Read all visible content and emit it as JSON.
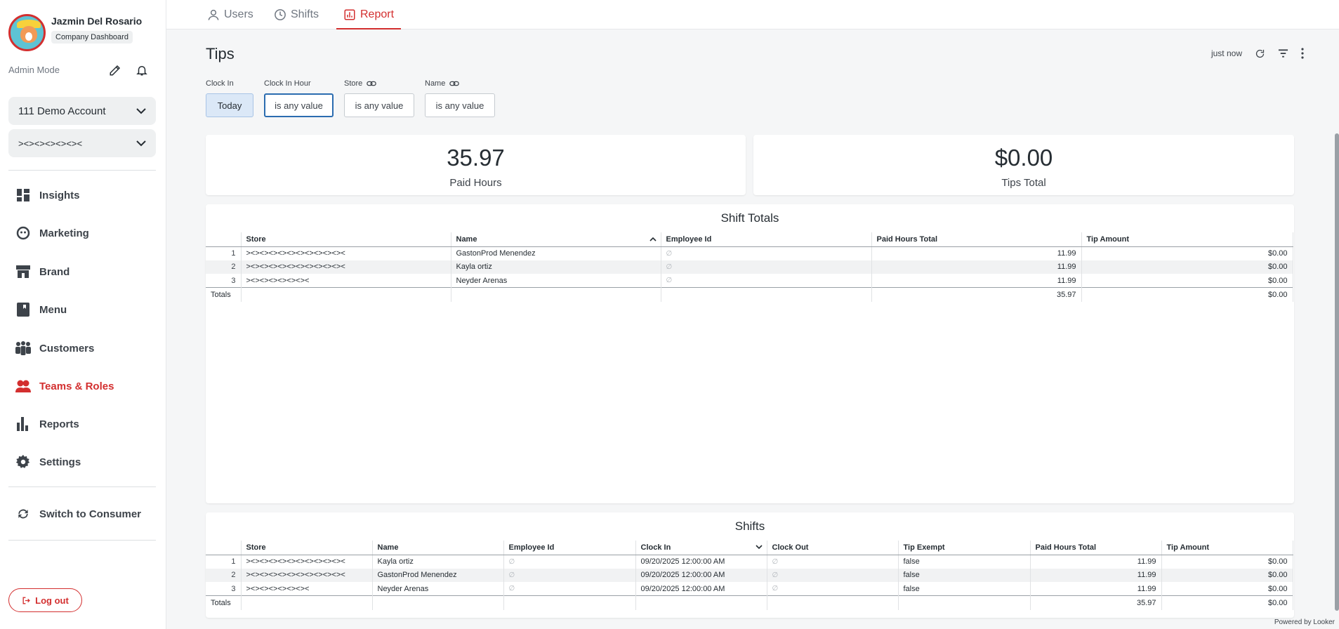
{
  "profile": {
    "name": "Jazmin Del Rosario",
    "company": "Company Dashboard"
  },
  "admin_mode_label": "Admin Mode",
  "account_select": {
    "value": "111 Demo Account"
  },
  "location_select": {
    "value": "><><><><><><"
  },
  "nav": [
    {
      "label": "Insights",
      "icon": "grid-icon"
    },
    {
      "label": "Marketing",
      "icon": "megaphone-icon"
    },
    {
      "label": "Brand",
      "icon": "store-icon"
    },
    {
      "label": "Menu",
      "icon": "book-icon"
    },
    {
      "label": "Customers",
      "icon": "people-icon"
    },
    {
      "label": "Teams & Roles",
      "icon": "team-icon",
      "active": true
    },
    {
      "label": "Reports",
      "icon": "bar-chart-icon"
    },
    {
      "label": "Settings",
      "icon": "gear-icon"
    }
  ],
  "switch_label": "Switch to Consumer",
  "logout_label": "Log out",
  "tabs": [
    {
      "label": "Users",
      "icon": "user-icon"
    },
    {
      "label": "Shifts",
      "icon": "clock-icon"
    },
    {
      "label": "Report",
      "icon": "report-icon",
      "active": true
    }
  ],
  "dashboard": {
    "title": "Tips",
    "updated": "just now",
    "filters": [
      {
        "label": "Clock In",
        "value": "Today"
      },
      {
        "label": "Clock In Hour",
        "value": "is any value"
      },
      {
        "label": "Store",
        "value": "is any value"
      },
      {
        "label": "Name",
        "value": "is any value"
      }
    ],
    "kpis": [
      {
        "value": "35.97",
        "label": "Paid Hours"
      },
      {
        "value": "$0.00",
        "label": "Tips Total"
      }
    ],
    "shift_totals": {
      "title": "Shift Totals",
      "columns": [
        "",
        "Store",
        "Name",
        "Employee Id",
        "Paid Hours Total",
        "Tip Amount"
      ],
      "rows": [
        [
          "1",
          "><><><><><><><><><><><",
          "GastonProd Menendez",
          "∅",
          "11.99",
          "$0.00"
        ],
        [
          "2",
          "><><><><><><><><><><><",
          "Kayla ortiz",
          "∅",
          "11.99",
          "$0.00"
        ],
        [
          "3",
          "><><><><><><><",
          "Neyder Arenas",
          "∅",
          "11.99",
          "$0.00"
        ]
      ],
      "totals": [
        "Totals",
        "",
        "",
        "",
        "35.97",
        "$0.00"
      ]
    },
    "shifts": {
      "title": "Shifts",
      "columns": [
        "",
        "Store",
        "Name",
        "Employee Id",
        "Clock In",
        "Clock Out",
        "Tip Exempt",
        "Paid Hours Total",
        "Tip Amount"
      ],
      "rows": [
        [
          "1",
          "><><><><><><><><><><><",
          "Kayla ortiz",
          "∅",
          "09/20/2025 12:00:00 AM",
          "∅",
          "false",
          "11.99",
          "$0.00"
        ],
        [
          "2",
          "><><><><><><><><><><><",
          "GastonProd Menendez",
          "∅",
          "09/20/2025 12:00:00 AM",
          "∅",
          "false",
          "11.99",
          "$0.00"
        ],
        [
          "3",
          "><><><><><><><",
          "Neyder Arenas",
          "∅",
          "09/20/2025 12:00:00 AM",
          "∅",
          "false",
          "11.99",
          "$0.00"
        ]
      ],
      "totals": [
        "Totals",
        "",
        "",
        "",
        "",
        "",
        "",
        "35.97",
        "$0.00"
      ]
    }
  },
  "powered_by": "Powered by Looker",
  "colors": {
    "accent": "#d32f2f",
    "filter_selected": "#dbe8f7"
  }
}
